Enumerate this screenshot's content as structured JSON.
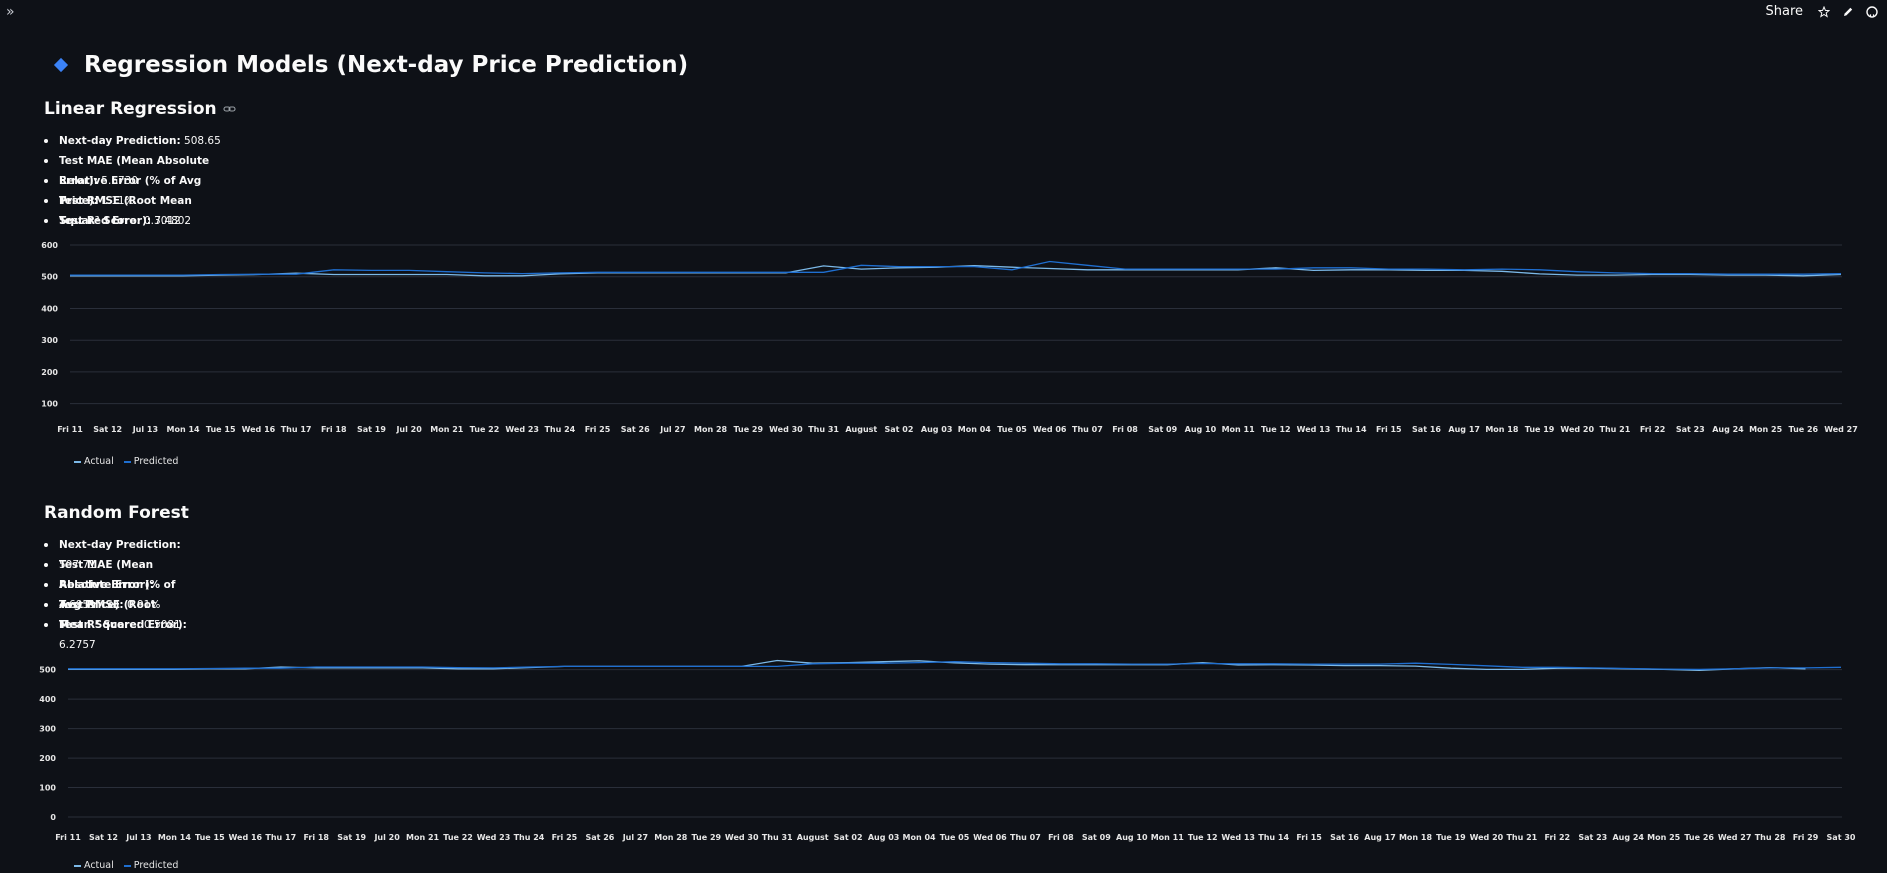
{
  "header": {
    "share_label": "Share",
    "icons": [
      "sidebar-toggle-icon",
      "star-icon",
      "pencil-icon",
      "github-icon"
    ]
  },
  "page": {
    "title": "Regression Models (Next-day Price Prediction)"
  },
  "colors": {
    "actual": "#7cb9e8",
    "predicted": "#1f6fd1",
    "grid": "#2a2f3a",
    "background": "#0e1117"
  },
  "sections": [
    {
      "heading": "Linear Regression",
      "metrics": [
        {
          "label": "Next-day Prediction:",
          "value": "508.65"
        },
        {
          "label": "Test MAE (Mean Absolute Error):",
          "value": "5.6730"
        },
        {
          "label": "Relative Error (% of Avg Price):",
          "value": "1.11%"
        },
        {
          "label": "Test RMSE (Root Mean Squared Error):",
          "value": "7.4802"
        },
        {
          "label": "Test R² Score:",
          "value": "0.3012"
        }
      ],
      "legend": [
        "Actual",
        "Predicted"
      ]
    },
    {
      "heading": "Random Forest",
      "metrics": [
        {
          "label": "Next-day Prediction:",
          "value": "507.71"
        },
        {
          "label": "Test MAE (Mean Absolute Error):",
          "value": "4.6951"
        },
        {
          "label": "Relative Error (% of Avg Price):",
          "value": "0.91%"
        },
        {
          "label": "Test RMSE (Root Mean Squared Error):",
          "value": "6.2757"
        },
        {
          "label": "Test R² Score:",
          "value": "0.5081"
        }
      ],
      "legend": [
        "Actual",
        "Predicted"
      ]
    }
  ],
  "chart_data": [
    {
      "type": "line",
      "ylim": [
        80,
        600
      ],
      "yticks": [
        100,
        200,
        300,
        400,
        500,
        600
      ],
      "x_labels": [
        "Fri 11",
        "Sat 12",
        "Jul 13",
        "Mon 14",
        "Tue 15",
        "Wed 16",
        "Thu 17",
        "Fri 18",
        "Sat 19",
        "Jul 20",
        "Mon 21",
        "Tue 22",
        "Wed 23",
        "Thu 24",
        "Fri 25",
        "Sat 26",
        "Jul 27",
        "Mon 28",
        "Tue 29",
        "Wed 30",
        "Thu 31",
        "August",
        "Sat 02",
        "Aug 03",
        "Mon 04",
        "Tue 05",
        "Wed 06",
        "Thu 07",
        "Fri 08",
        "Sat 09",
        "Aug 10",
        "Mon 11",
        "Tue 12",
        "Wed 13",
        "Thu 14",
        "Fri 15",
        "Sat 16",
        "Aug 17",
        "Mon 18",
        "Tue 19",
        "Wed 20",
        "Thu 21",
        "Fri 22",
        "Sat 23",
        "Aug 24",
        "Mon 25",
        "Tue 26",
        "Wed 27"
      ],
      "series": [
        {
          "name": "Actual",
          "values": [
            503,
            503,
            503,
            503,
            505,
            507,
            511,
            507,
            507,
            507,
            507,
            503,
            503,
            509,
            512,
            512,
            512,
            512,
            512,
            512,
            534,
            524,
            528,
            530,
            535,
            530,
            526,
            522,
            522,
            522,
            522,
            522,
            528,
            520,
            522,
            522,
            520,
            520,
            517,
            509,
            505,
            505,
            507,
            507,
            505,
            505,
            503,
            507
          ]
        },
        {
          "name": "Predicted",
          "values": [
            505,
            505,
            505,
            505,
            507,
            508,
            508,
            522,
            520,
            520,
            516,
            512,
            510,
            512,
            514,
            514,
            514,
            514,
            514,
            514,
            514,
            536,
            532,
            532,
            532,
            522,
            548,
            536,
            524,
            524,
            524,
            524,
            524,
            528,
            528,
            524,
            524,
            522,
            524,
            522,
            516,
            512,
            510,
            510,
            508,
            508,
            508,
            510
          ]
        }
      ]
    },
    {
      "type": "line",
      "ylim": [
        0,
        560
      ],
      "yticks": [
        0,
        100,
        200,
        300,
        400,
        500
      ],
      "x_labels": [
        "Fri 11",
        "Sat 12",
        "Jul 13",
        "Mon 14",
        "Tue 15",
        "Wed 16",
        "Thu 17",
        "Fri 18",
        "Sat 19",
        "Jul 20",
        "Mon 21",
        "Tue 22",
        "Wed 23",
        "Thu 24",
        "Fri 25",
        "Sat 26",
        "Jul 27",
        "Mon 28",
        "Tue 29",
        "Wed 30",
        "Thu 31",
        "August",
        "Sat 02",
        "Aug 03",
        "Mon 04",
        "Tue 05",
        "Wed 06",
        "Thu 07",
        "Fri 08",
        "Sat 09",
        "Aug 10",
        "Mon 11",
        "Tue 12",
        "Wed 13",
        "Thu 14",
        "Fri 15",
        "Sat 16",
        "Aug 17",
        "Mon 18",
        "Tue 19",
        "Wed 20",
        "Thu 21",
        "Fri 22",
        "Sat 23",
        "Aug 24",
        "Mon 25",
        "Tue 26",
        "Wed 27",
        "Thu 28",
        "Fri 29",
        "Sat 30"
      ],
      "series": [
        {
          "name": "Actual",
          "values": [
            501,
            501,
            501,
            501,
            503,
            503,
            509,
            506,
            506,
            506,
            506,
            503,
            503,
            507,
            511,
            511,
            511,
            511,
            511,
            511,
            531,
            522,
            524,
            527,
            530,
            523,
            519,
            517,
            517,
            517,
            517,
            517,
            524,
            516,
            517,
            516,
            514,
            514,
            512,
            505,
            501,
            501,
            505,
            505,
            503,
            501,
            498,
            503,
            507,
            503,
            null
          ]
        },
        {
          "name": "Predicted",
          "values": [
            503,
            503,
            503,
            503,
            504,
            505,
            505,
            509,
            509,
            509,
            509,
            507,
            506,
            509,
            511,
            511,
            511,
            511,
            511,
            511,
            511,
            520,
            522,
            522,
            524,
            527,
            524,
            522,
            520,
            520,
            519,
            519,
            521,
            520,
            520,
            519,
            519,
            519,
            522,
            518,
            513,
            508,
            508,
            506,
            504,
            502,
            501,
            503,
            506,
            506,
            508
          ]
        }
      ]
    }
  ]
}
